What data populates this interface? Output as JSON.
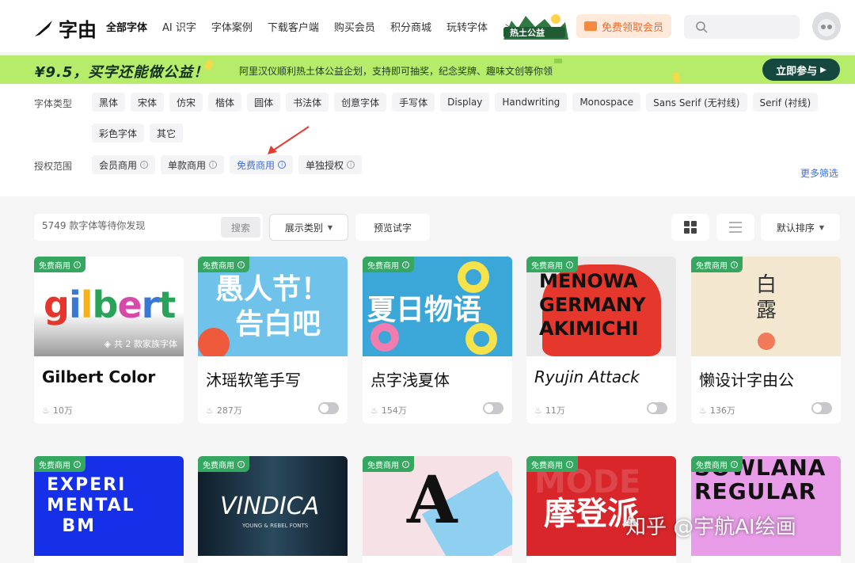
{
  "header": {
    "logo_text": "字由",
    "nav": [
      {
        "label": "全部字体",
        "active": true
      },
      {
        "label": "AI 识字"
      },
      {
        "label": "字体案例"
      },
      {
        "label": "下载客户端"
      },
      {
        "label": "购买会员"
      },
      {
        "label": "积分商城"
      },
      {
        "label": "玩转字体"
      }
    ],
    "charity_badge": "热土公益",
    "vip_button": "免费领取会员"
  },
  "banner": {
    "title": "¥9.5，买字还能做公益！",
    "description": "阿里汉仪顺利热土体公益企划，支持即可抽奖，纪念奖牌、趣味文创等你领",
    "cta": "立即参与"
  },
  "filters": {
    "type_label": "字体类型",
    "types_row1": [
      "黑体",
      "宋体",
      "仿宋",
      "楷体",
      "圆体",
      "书法体",
      "创意字体",
      "手写体",
      "Display",
      "Handwriting",
      "Monospace",
      "Sans Serif (无衬线)",
      "Serif (衬线)"
    ],
    "types_row2": [
      "彩色字体",
      "其它"
    ],
    "license_label": "授权范围",
    "licenses": [
      {
        "label": "会员商用",
        "selected": false
      },
      {
        "label": "单款商用",
        "selected": false
      },
      {
        "label": "免费商用",
        "selected": true
      },
      {
        "label": "单独授权",
        "selected": false
      }
    ],
    "more": "更多筛选"
  },
  "toolbar": {
    "search_placeholder": "5749 款字体等待你发现",
    "search_button": "搜索",
    "category_button": "展示类别",
    "preview_button": "预览试字",
    "sort_button": "默认排序"
  },
  "free_tag": "免费商用",
  "cards": [
    {
      "name": "Gilbert Color",
      "hot": "10万",
      "family": "共 2 款家族字体",
      "art": "gilbert"
    },
    {
      "name": "沐瑶软笔手写",
      "hot": "287万",
      "art": "愚人节！告白吧"
    },
    {
      "name": "点字浅夏体",
      "hot": "154万",
      "art": "夏日物语"
    },
    {
      "name": "Ryujin Attack",
      "hot": "11万",
      "art": "MENOWA GERMANY AKIMICHI"
    },
    {
      "name": "懒设计字由公",
      "hot": "136万",
      "art": "白露"
    }
  ],
  "cards_row2": [
    {
      "art": "EXPERI MENTAL BM"
    },
    {
      "art": "VINDICA",
      "sub": "YOUNG & REBEL FONTS"
    },
    {
      "art": "A"
    },
    {
      "art": "摩登派",
      "sub": "MODE"
    },
    {
      "art": "SOWLANA REGULAR"
    }
  ],
  "watermark": "知乎 @宇航AI绘画",
  "colors": {
    "accent": "#3d6ee0",
    "free_tag": "#35a761",
    "banner": "#b6ec6a",
    "vip": "#f0692b"
  }
}
